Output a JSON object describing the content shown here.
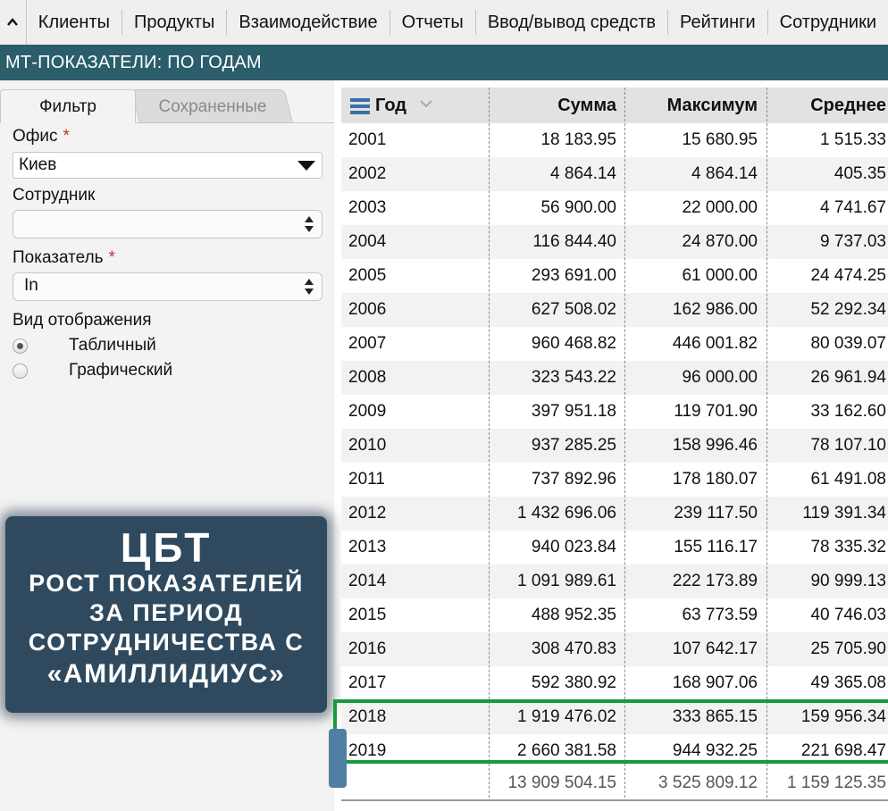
{
  "nav": {
    "items": [
      "Клиенты",
      "Продукты",
      "Взаимодействие",
      "Отчеты",
      "Ввод/вывод средств",
      "Рейтинги",
      "Сотрудники"
    ]
  },
  "title": "МТ-ПОКАЗАТЕЛИ: ПО ГОДАМ",
  "filter": {
    "tab_active": "Фильтр",
    "tab_saved": "Сохраненные",
    "office_label": "Офис",
    "office_value": "Киев",
    "employee_label": "Сотрудник",
    "employee_value": "",
    "indicator_label": "Показатель",
    "indicator_value": "In",
    "view_label": "Вид отображения",
    "view_table": "Табличный",
    "view_graph": "Графический",
    "required_mark": "*"
  },
  "promo": {
    "line1": "ЦБТ",
    "line2": "РОСТ ПОКАЗАТЕЛЕЙ",
    "line3": "ЗА ПЕРИОД",
    "line4": "СОТРУДНИЧЕСТВА С",
    "line5": "«АМИЛЛИДИУС»"
  },
  "table": {
    "headers": [
      "Год",
      "Сумма",
      "Максимум",
      "Среднее"
    ],
    "rows": [
      [
        "2001",
        "18 183.95",
        "15 680.95",
        "1 515.33"
      ],
      [
        "2002",
        "4 864.14",
        "4 864.14",
        "405.35"
      ],
      [
        "2003",
        "56 900.00",
        "22 000.00",
        "4 741.67"
      ],
      [
        "2004",
        "116 844.40",
        "24 870.00",
        "9 737.03"
      ],
      [
        "2005",
        "293 691.00",
        "61 000.00",
        "24 474.25"
      ],
      [
        "2006",
        "627 508.02",
        "162 986.00",
        "52 292.34"
      ],
      [
        "2007",
        "960 468.82",
        "446 001.82",
        "80 039.07"
      ],
      [
        "2008",
        "323 543.22",
        "96 000.00",
        "26 961.94"
      ],
      [
        "2009",
        "397 951.18",
        "119 701.90",
        "33 162.60"
      ],
      [
        "2010",
        "937 285.25",
        "158 996.46",
        "78 107.10"
      ],
      [
        "2011",
        "737 892.96",
        "178 180.07",
        "61 491.08"
      ],
      [
        "2012",
        "1 432 696.06",
        "239 117.50",
        "119 391.34"
      ],
      [
        "2013",
        "940 023.84",
        "155 116.17",
        "78 335.32"
      ],
      [
        "2014",
        "1 091 989.61",
        "222 173.89",
        "90 999.13"
      ],
      [
        "2015",
        "488 952.35",
        "63 773.59",
        "40 746.03"
      ],
      [
        "2016",
        "308 470.83",
        "107 642.17",
        "25 705.90"
      ],
      [
        "2017",
        "592 380.92",
        "168 907.06",
        "49 365.08"
      ],
      [
        "2018",
        "1 919 476.02",
        "333 865.15",
        "159 956.34"
      ],
      [
        "2019",
        "2 660 381.58",
        "944 932.25",
        "221 698.47"
      ]
    ],
    "totals": [
      "",
      "13 909 504.15",
      "3 525 809.12",
      "1 159 125.35"
    ]
  },
  "colors": {
    "title_bar": "#2b5d6b",
    "highlight": "#159a3e",
    "promo_bg": "#2f4a5e",
    "required": "#c0392b"
  }
}
